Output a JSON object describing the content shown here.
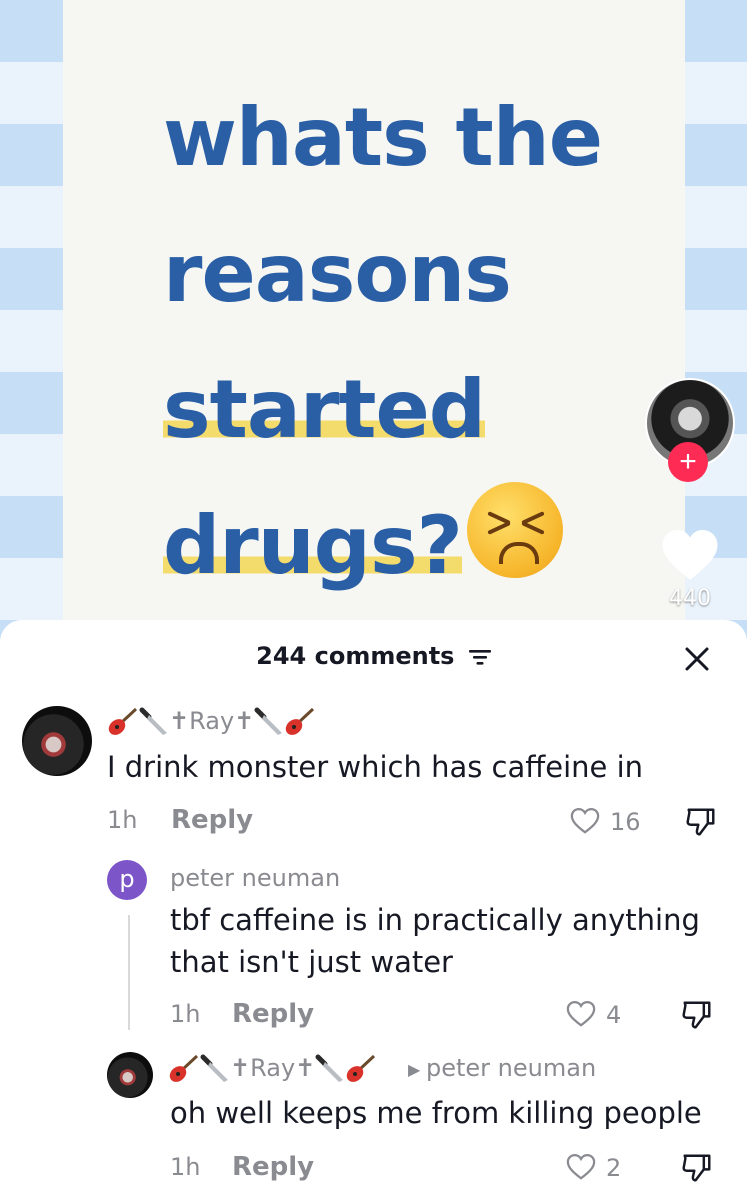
{
  "video": {
    "headline": {
      "line1": "whats the",
      "line2": "reasons",
      "line3": "started",
      "line4": "drugs?"
    },
    "follow_symbol": "+",
    "like_count": "440"
  },
  "comments_sheet": {
    "header": "244 comments",
    "comments": [
      {
        "username": "✝Ray✝",
        "text": "I drink monster which has caffeine in",
        "time": "1h",
        "reply_label": "Reply",
        "likes": "16"
      },
      {
        "avatar_initial": "p",
        "username": "peter neuman",
        "text_line1": "tbf caffeine is in practically anything",
        "text_line2": "that isn't just water",
        "time": "1h",
        "reply_label": "Reply",
        "likes": "4"
      },
      {
        "username": "✝Ray✝",
        "reply_to": "peter neuman",
        "text": "oh well keeps me from killing people",
        "time": "1h",
        "reply_label": "Reply",
        "likes": "2"
      }
    ]
  },
  "icons": [
    "guitar-emoji",
    "knife-emoji",
    "persevering-face-emoji",
    "heart-icon",
    "dislike-icon",
    "close-icon",
    "filter-icon",
    "plus-icon"
  ],
  "colors": {
    "headline_blue": "#2a5fa6",
    "highlight_yellow": "#f4dc6c",
    "follow_red": "#fe2c55",
    "avatar_purple": "#7c55c9",
    "meta_gray": "#8a8b91"
  }
}
